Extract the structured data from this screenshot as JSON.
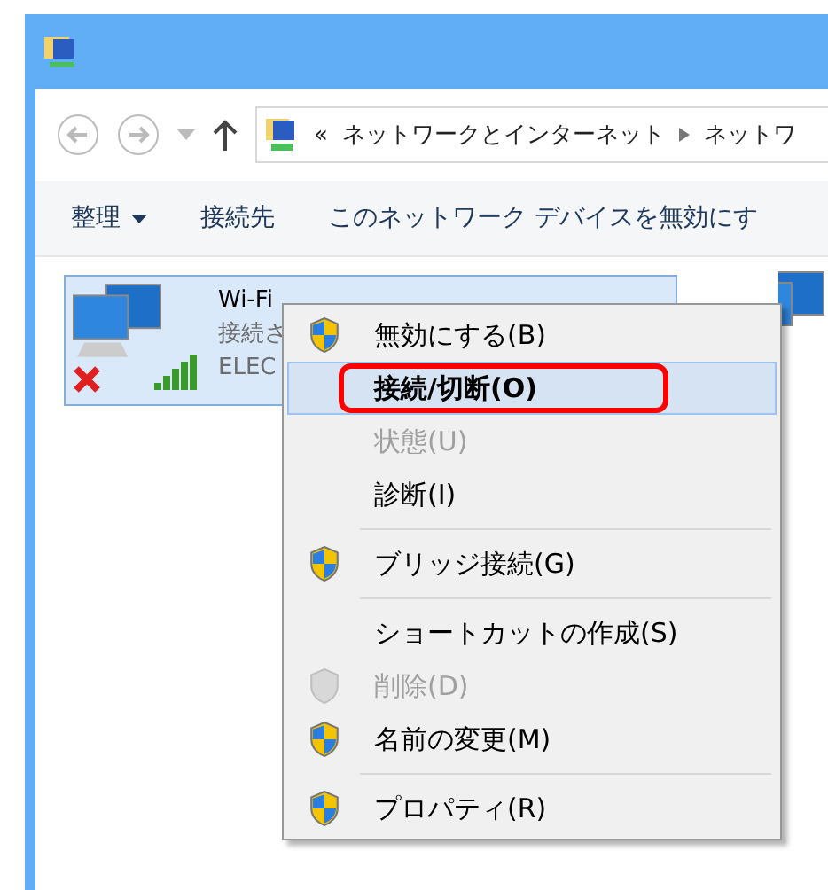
{
  "address_bar": {
    "overflow": "«",
    "segments": [
      "ネットワークとインターネット",
      "ネットワ"
    ]
  },
  "toolbar": {
    "items": [
      {
        "label": "整理",
        "dropdown": true
      },
      {
        "label": "接続先",
        "dropdown": false
      },
      {
        "label": "このネットワーク デバイスを無効にす",
        "dropdown": false
      }
    ]
  },
  "adapter": {
    "name": "Wi-Fi",
    "status": "接続さ",
    "device": "ELEC",
    "selected": true,
    "disconnected": true
  },
  "context_menu": {
    "items": [
      {
        "label": "無効にする(B)",
        "shield": true,
        "disabled": false,
        "selected": false,
        "highlighted": false,
        "separator_before": false
      },
      {
        "label": "接続/切断(O)",
        "shield": false,
        "disabled": false,
        "selected": true,
        "highlighted": true,
        "separator_before": false
      },
      {
        "label": "状態(U)",
        "shield": false,
        "disabled": true,
        "selected": false,
        "highlighted": false,
        "separator_before": false
      },
      {
        "label": "診断(I)",
        "shield": false,
        "disabled": false,
        "selected": false,
        "highlighted": false,
        "separator_before": false
      },
      {
        "label": "ブリッジ接続(G)",
        "shield": true,
        "disabled": false,
        "selected": false,
        "highlighted": false,
        "separator_before": true
      },
      {
        "label": "ショートカットの作成(S)",
        "shield": false,
        "disabled": false,
        "selected": false,
        "highlighted": false,
        "separator_before": true
      },
      {
        "label": "削除(D)",
        "shield": true,
        "disabled": true,
        "selected": false,
        "highlighted": false,
        "separator_before": false
      },
      {
        "label": "名前の変更(M)",
        "shield": true,
        "disabled": false,
        "selected": false,
        "highlighted": false,
        "separator_before": false
      },
      {
        "label": "プロパティ(R)",
        "shield": true,
        "disabled": false,
        "selected": false,
        "highlighted": false,
        "separator_before": true
      }
    ]
  }
}
